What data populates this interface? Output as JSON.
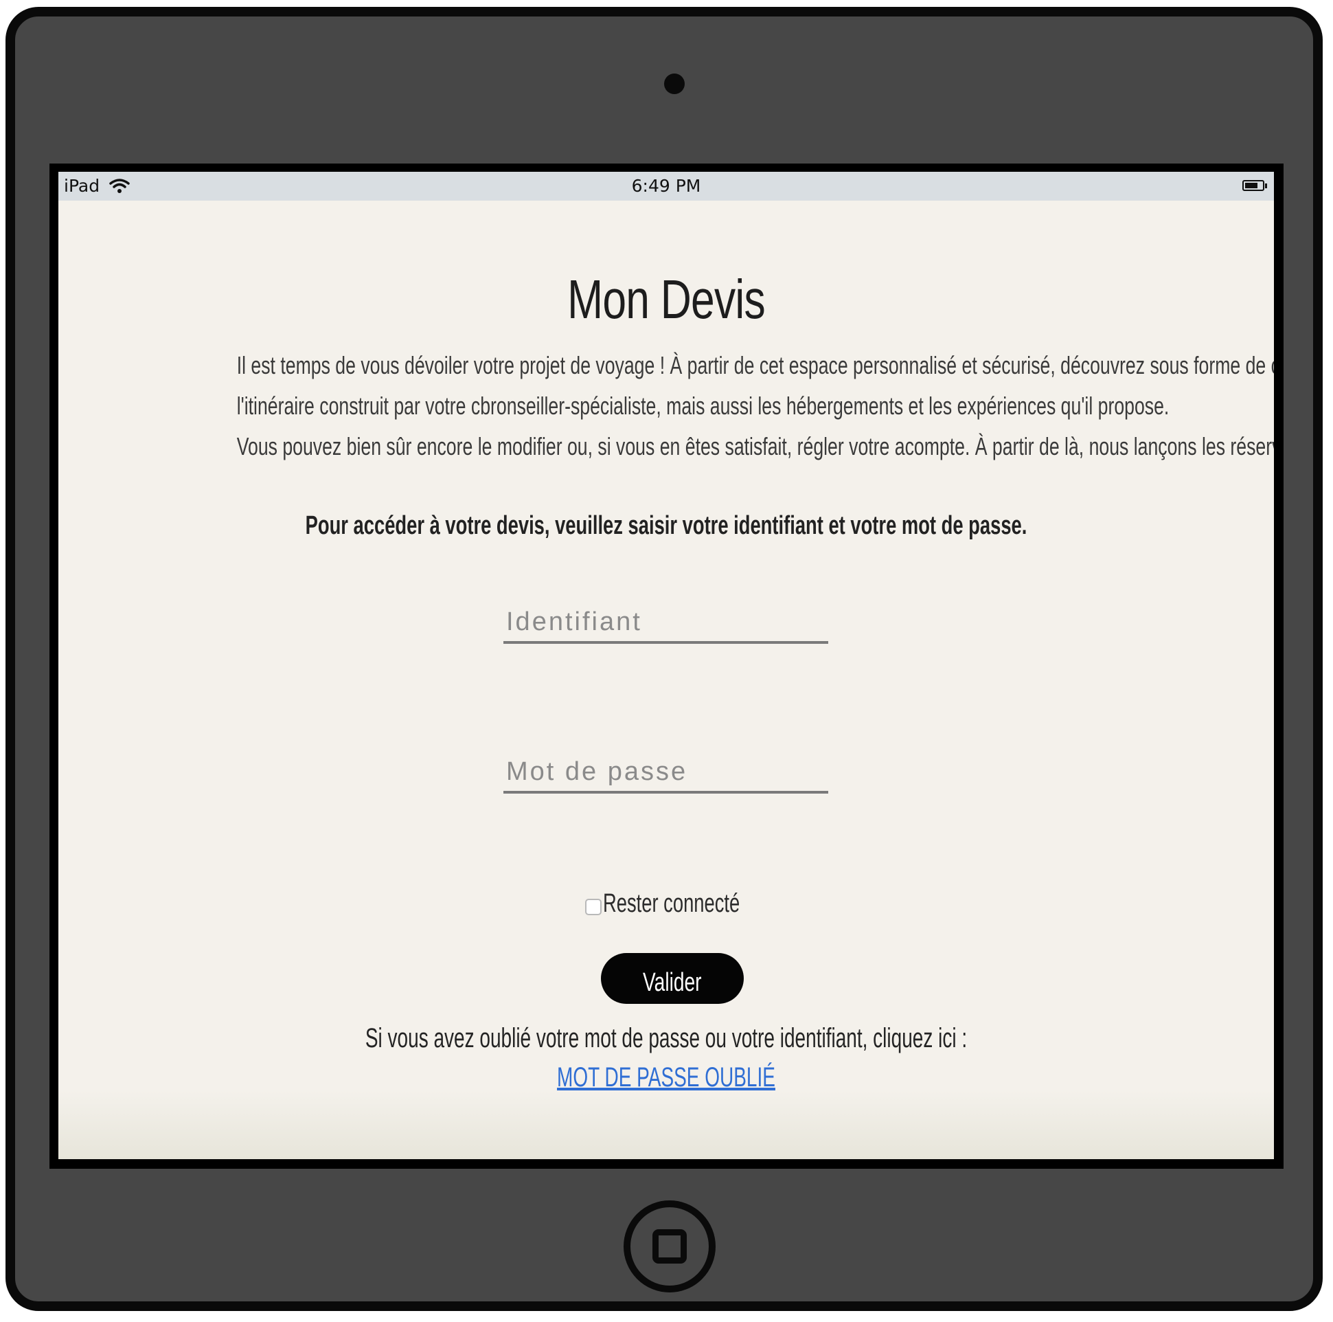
{
  "status_bar": {
    "device": "iPad",
    "time": "6:49 PM"
  },
  "page": {
    "title": "Mon Devis",
    "intro_lines": [
      "Il est temps de vous dévoiler votre projet de voyage ! À partir de cet espace personnalisé et sécurisé, découvrez sous forme de carte",
      "l'itinéraire construit par votre cbronseiller-spécialiste, mais aussi les hébergements et les expériences qu'il propose.",
      "Vous pouvez bien sûr encore le modifier ou, si vous en êtes satisfait, régler votre acompte. À partir de là, nous lançons les réservations."
    ],
    "instruction": "Pour accéder à votre devis, veuillez saisir votre identifiant et votre mot de passe."
  },
  "form": {
    "identifiant_placeholder": "Identifiant",
    "password_placeholder": "Mot de passe",
    "remember_label": "Rester connecté",
    "remember_checked": false,
    "submit_label": "Valider"
  },
  "forgot": {
    "text": "Si vous avez oublié votre mot de passe ou votre identifiant, cliquez ici :",
    "link_label": "MOT DE PASSE OUBLIÉ"
  },
  "colors": {
    "frame": "#474747",
    "screen_bg": "#f4f1eb",
    "status_bar_bg": "#d9dee2",
    "button_bg": "#050505",
    "link": "#2f6ed4"
  },
  "icons": {
    "status_left": "wifi-icon",
    "status_right": "battery-icon"
  }
}
